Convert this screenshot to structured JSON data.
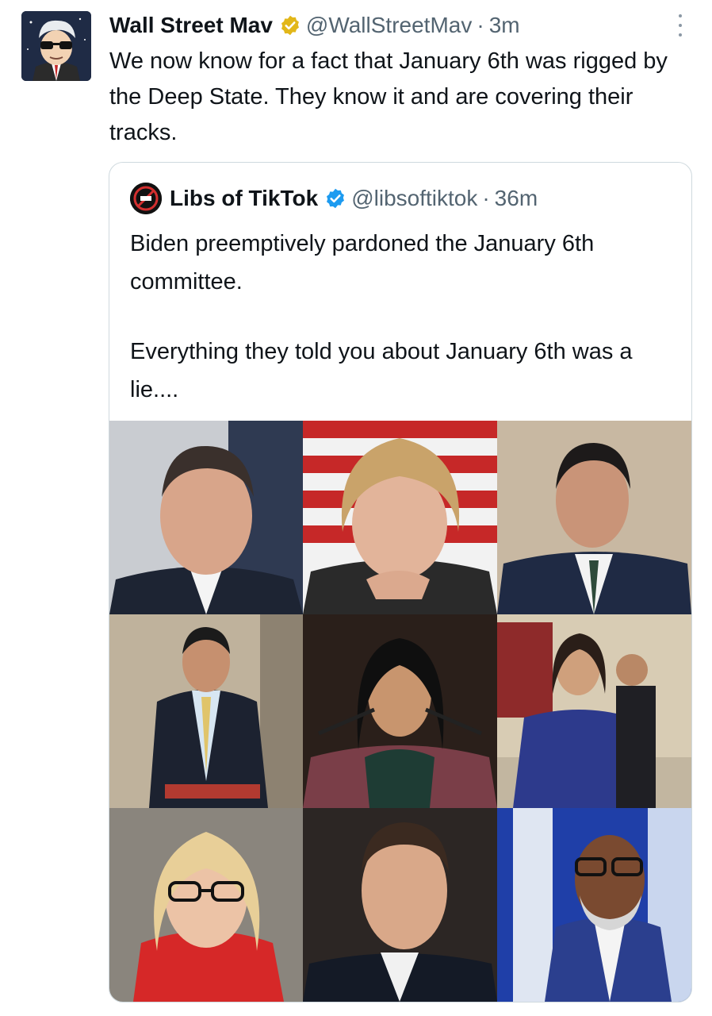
{
  "tweet": {
    "author_name": "Wall Street Mav",
    "author_handle": "@WallStreetMav",
    "separator": "·",
    "time": "3m",
    "text": "We now know for a fact that January 6th was rigged by the Deep State. They know it and are covering their tracks.",
    "verified_badge_color": "#e2b719",
    "avatar_icon": "sunglasses-character-avatar-icon"
  },
  "quoted": {
    "author_name": "Libs of TikTok",
    "author_handle": "@libsoftiktok",
    "separator": "·",
    "time": "36m",
    "paragraphs": [
      "Biden preemptively pardoned the January 6th committee.",
      "Everything they told you about January 6th was a lie...."
    ],
    "verified_badge_color": "#1d9bf0",
    "avatar_icon": "libs-of-tiktok-logo-icon",
    "photo_count": 9
  },
  "colors": {
    "text": "#0f1419",
    "secondary_text": "#536471",
    "border": "#cfd9de"
  }
}
